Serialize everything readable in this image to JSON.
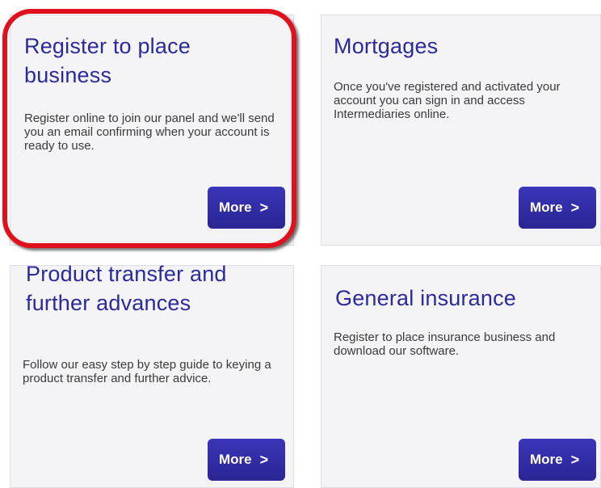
{
  "cards": [
    {
      "title": "Register to place business",
      "description": "Register online to join our panel and we'll send you an email confirming when your account is ready to use.",
      "button_label": "More",
      "button_chevron": ">"
    },
    {
      "title": "Mortgages",
      "description": "Once you've registered and activated your account you can sign in and access Intermediaries online.",
      "button_label": "More",
      "button_chevron": ">"
    },
    {
      "title": "Product transfer and further advances",
      "description": "Follow our easy step by step guide to keying a product transfer and further advice.",
      "button_label": "More",
      "button_chevron": ">"
    },
    {
      "title": "General insurance",
      "description": "Register to place insurance business and download our software.",
      "button_label": "More",
      "button_chevron": ">"
    }
  ],
  "colors": {
    "title": "#2b2a98",
    "button": "#2f2aa6",
    "highlight": "#e0101c",
    "card_background": "#f4f4f6"
  }
}
